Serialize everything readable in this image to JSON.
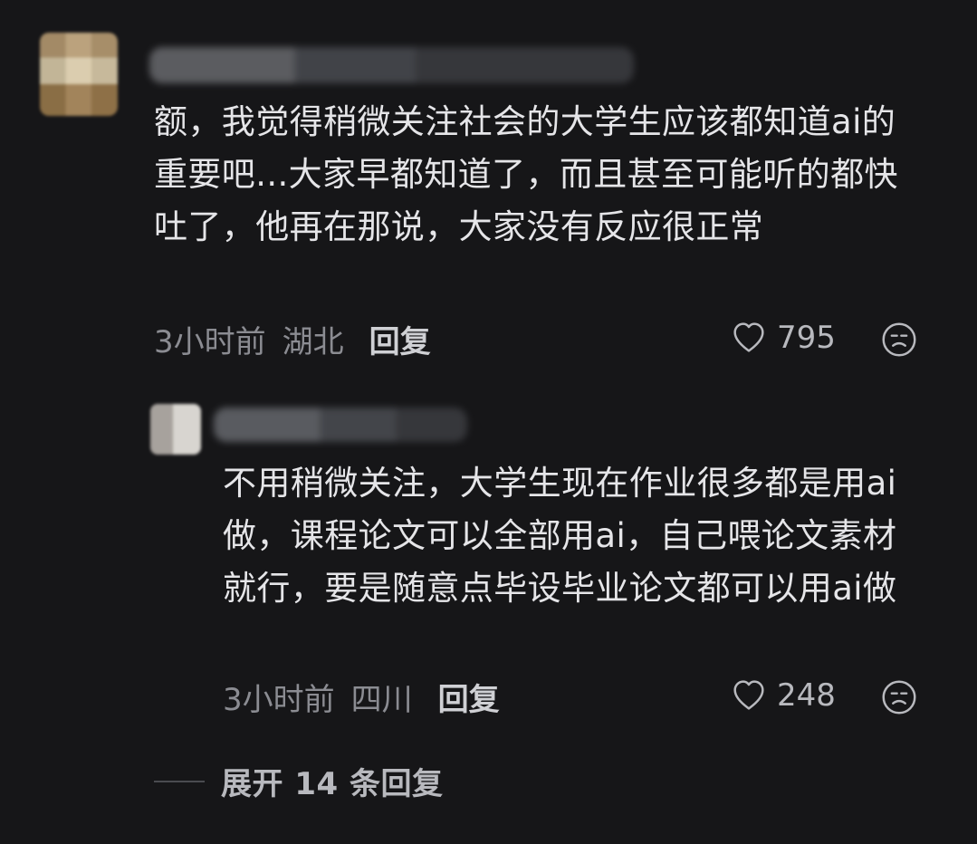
{
  "comments": [
    {
      "text": "额，我觉得稍微关注社会的大学生应该都知道ai的重要吧...大家早都知道了，而且甚至可能听的都快吐了，他再在那说，大家没有反应很正常",
      "time": "3小时前",
      "location": "湖北",
      "reply_label": "回复",
      "likes": "795",
      "icons": {
        "like": "heart-icon",
        "dislike": "sad-face-icon"
      }
    },
    {
      "text": "不用稍微关注，大学生现在作业很多都是用ai做，课程论文可以全部用ai，自己喂论文素材就行，要是随意点毕设毕业论文都可以用ai做",
      "time": "3小时前",
      "location": "四川",
      "reply_label": "回复",
      "likes": "248",
      "icons": {
        "like": "heart-icon",
        "dislike": "sad-face-icon"
      }
    }
  ],
  "thread": {
    "expand_label": "展开 14 条回复"
  },
  "colors": {
    "background": "#161618",
    "primary_text": "#e5e5e8",
    "secondary_text": "#8b8c92",
    "accent_text": "#cfd0d4"
  }
}
